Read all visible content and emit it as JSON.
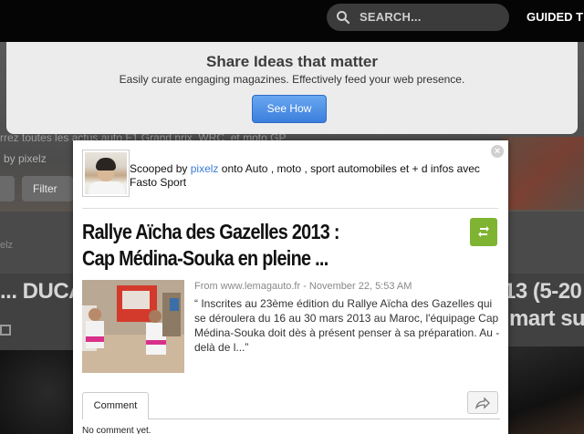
{
  "topbar": {
    "search_placeholder": "SEARCH...",
    "guided_label": "GUIDED T"
  },
  "background": {
    "hero_text": "rrez toutes les actus auto F1 Grand prix, WRC, et moto GP",
    "by_text": "by pixelz",
    "filter_label": "Filter",
    "elz_label": "elz",
    "left_headline": "... DUCA",
    "right_headline_1": "13 (5-20",
    "right_headline_2": "mart sur"
  },
  "banner": {
    "title": "Share Ideas that matter",
    "subtitle": "Easily curate engaging magazines. Effectively feed your web presence.",
    "button_label": "See How"
  },
  "card": {
    "close_label": "×",
    "scooped_by_prefix": "Scooped by",
    "user": "pixelz",
    "scooped_suffix": "onto Auto , moto , sport automobiles et + d infos avec Fasto Sport",
    "headline_line1": "Rallye Aïcha des Gazelles 2013 :",
    "headline_line2": "Cap Médina-Souka en pleine ...",
    "source": "From www.lemagauto.fr - November 22, 5:53 AM",
    "excerpt": "“ Inscrites au 23ème édition du Rallye Aïcha des Gazelles qui se déroulera du 16 au 30 mars 2013 au Maroc, l'équipage Cap Médina-Souka doit dès à présent penser à sa préparation. Au -delà de l...”",
    "tab_label": "Comment",
    "no_comment": "No comment yet."
  },
  "colors": {
    "accent_blue": "#3b7fdd",
    "rescoop_green": "#7fb332",
    "user_link": "#3a7bd5"
  }
}
